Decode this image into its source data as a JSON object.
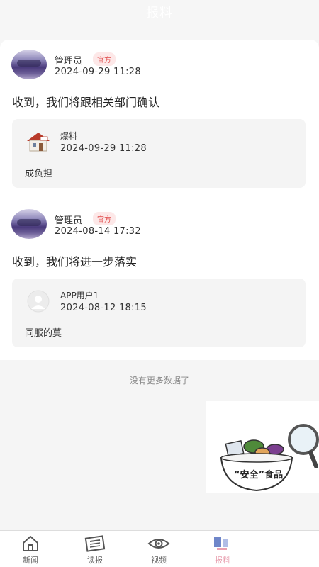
{
  "header": {
    "title": "报料"
  },
  "posts": [
    {
      "user": "管理员",
      "badge": "官方",
      "time": "2024-09-29  11:28",
      "text": "收到，我们将跟相关部门确认",
      "quote": {
        "user": "爆料",
        "time": "2024-09-29  11:28",
        "text": "成负担"
      }
    },
    {
      "user": "管理员",
      "badge": "官方",
      "time": "2024-08-14  17:32",
      "text": "收到，我们将进一步落实",
      "quote": {
        "user": "APP用户1",
        "time": "2024-08-12  18:15",
        "text": "同服的莫"
      }
    }
  ],
  "list_end": "没有更多数据了",
  "ad": {
    "text": "“安全”食品"
  },
  "tabbar": {
    "items": [
      {
        "label": "新闻",
        "icon": "home-icon"
      },
      {
        "label": "读报",
        "icon": "newspaper-icon"
      },
      {
        "label": "视频",
        "icon": "eye-icon"
      },
      {
        "label": "报料",
        "icon": "report-icon"
      }
    ]
  },
  "colors": {
    "badge_text": "#e04b4b",
    "badge_bg": "#fde8e8",
    "card_bg": "#f4f4f4"
  }
}
